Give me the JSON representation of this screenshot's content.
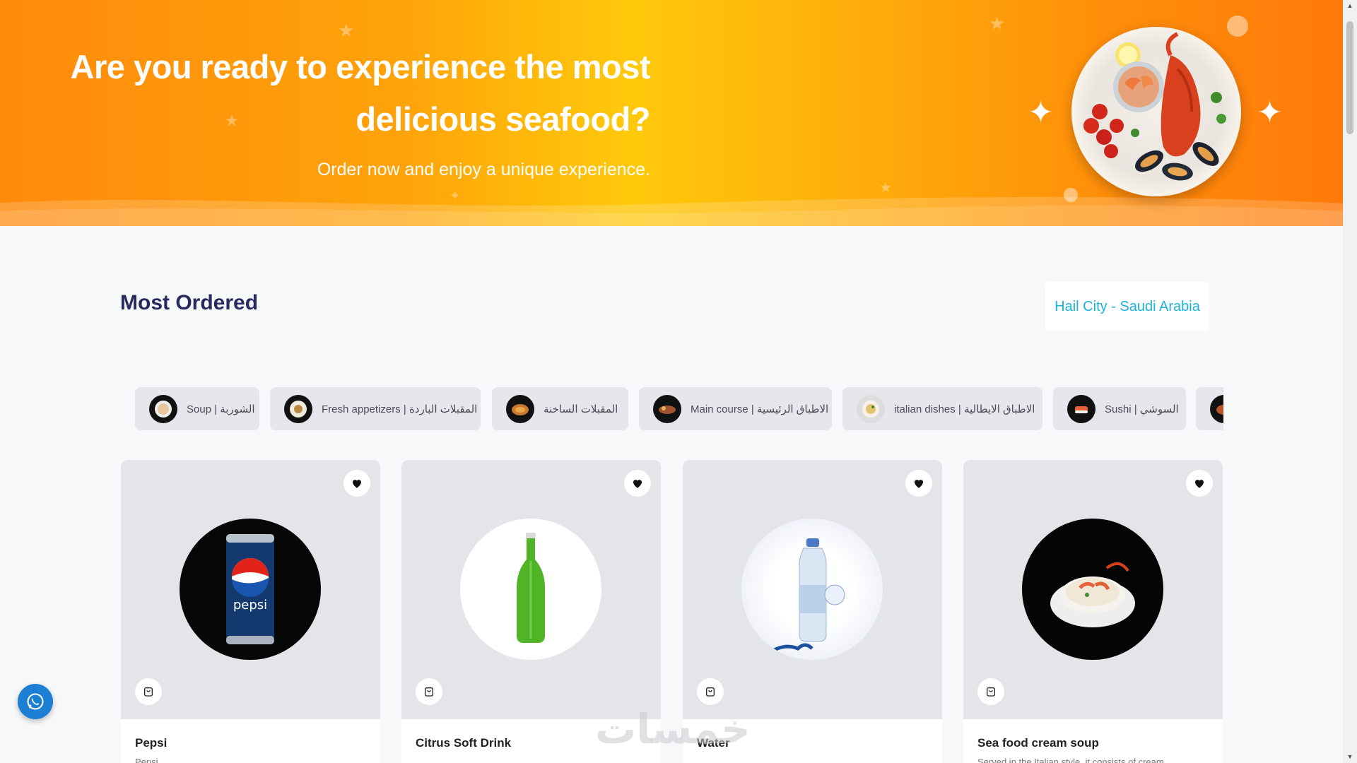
{
  "hero": {
    "title": "Are you ready to experience the most delicious seafood?",
    "subtitle": "Order now and enjoy a unique experience."
  },
  "section": {
    "title": "Most Ordered",
    "city": "Hail City - Saudi Arabia"
  },
  "categories": [
    {
      "label": "Soup | الشوربة"
    },
    {
      "label": "Fresh appetizers | المقبلات الباردة"
    },
    {
      "label": "المقبلات الساخنة"
    },
    {
      "label": "Main course | الاطباق الرئيسية"
    },
    {
      "label": "italian dishes | الاطباق الايطالية"
    },
    {
      "label": "Sushi | السوشي"
    }
  ],
  "products": [
    {
      "name": "Pepsi",
      "description": "Pepsi"
    },
    {
      "name": "Citrus Soft Drink",
      "description": ""
    },
    {
      "name": "Water",
      "description": ""
    },
    {
      "name": "Sea food cream soup",
      "description": "Served in the Italian style, it consists of cream"
    }
  ],
  "icons": {
    "favorite": "heart-icon",
    "cart": "shopping-bag-icon",
    "whatsapp": "whatsapp-icon"
  },
  "watermark": "خمسات",
  "colors": {
    "hero_gradient_start": "#ff8a0c",
    "hero_gradient_mid": "#ffc90b",
    "title_navy": "#262a5e",
    "city_cyan": "#1bb3d6",
    "whatsapp_blue": "#1d7fd3"
  }
}
